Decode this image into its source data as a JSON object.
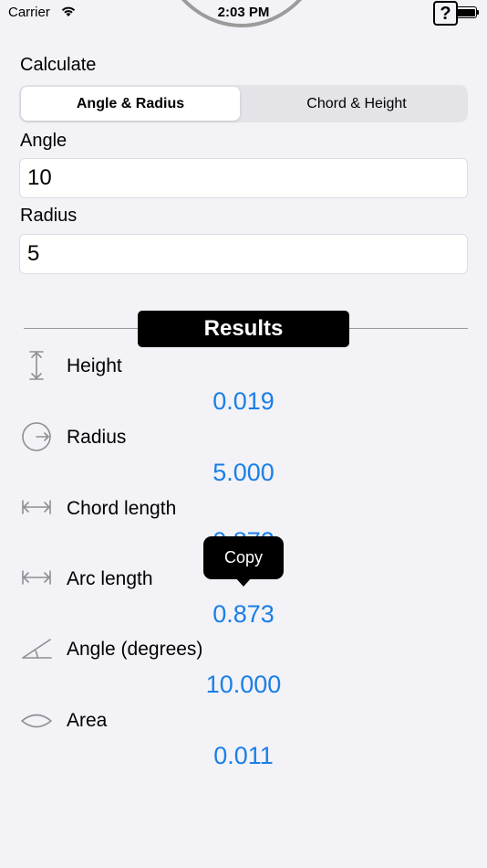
{
  "status_bar": {
    "carrier": "Carrier",
    "time": "2:03 PM",
    "help_icon": "question-mark",
    "battery_icon": "battery-full"
  },
  "form": {
    "calculate_label": "Calculate",
    "segments": [
      "Angle & Radius",
      "Chord & Height"
    ],
    "selected_segment": "Angle & Radius",
    "angle_label": "Angle",
    "angle_value": "10",
    "radius_label": "Radius",
    "radius_value": "5"
  },
  "results": {
    "title": "Results",
    "items": [
      {
        "label": "Height",
        "value": "0.019",
        "icon": "height-icon"
      },
      {
        "label": "Radius",
        "value": "5.000",
        "icon": "radius-icon"
      },
      {
        "label": "Chord length",
        "value": "0.872",
        "icon": "chord-length-icon"
      },
      {
        "label": "Arc length",
        "value": "0.873",
        "icon": "arc-length-icon"
      },
      {
        "label": "Angle (degrees)",
        "value": "10.000",
        "icon": "angle-icon"
      },
      {
        "label": "Area",
        "value": "0.011",
        "icon": "area-icon"
      }
    ]
  },
  "tooltip": {
    "label": "Copy"
  },
  "colors": {
    "background": "#f2f2f7",
    "accent": "#1a7fe6"
  }
}
